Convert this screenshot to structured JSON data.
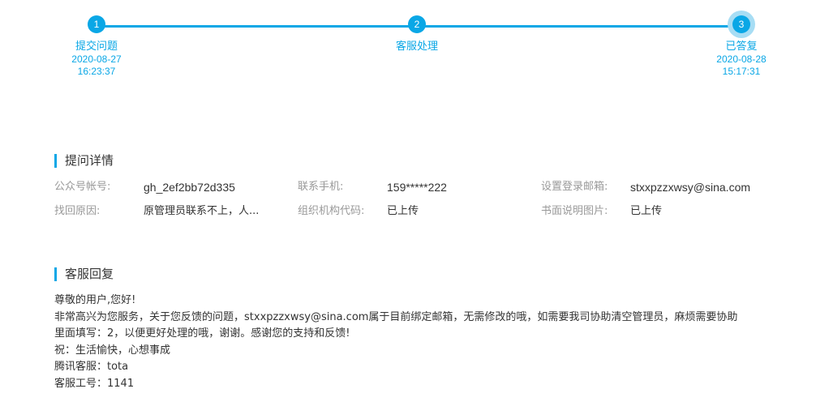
{
  "steps": [
    {
      "num": "1",
      "label": "提交问题",
      "date": "2020-08-27",
      "time": "16:23:37"
    },
    {
      "num": "2",
      "label": "客服处理",
      "date": "",
      "time": ""
    },
    {
      "num": "3",
      "label": "已答复",
      "date": "2020-08-28",
      "time": "15:17:31"
    }
  ],
  "details": {
    "title": "提问详情",
    "official_account_label": "公众号帐号:",
    "official_account_value": "gh_2ef2bb72d335",
    "phone_label": "联系手机:",
    "phone_value": "159*****222",
    "login_email_label": "设置登录邮箱:",
    "login_email_value": "stxxpzzxwsy@sina.com",
    "reason_label": "找回原因:",
    "reason_value": "原管理员联系不上，人...",
    "org_code_label": "组织机构代码:",
    "org_code_value": "已上传",
    "written_image_label": "书面说明图片:",
    "written_image_value": "已上传"
  },
  "reply": {
    "title": "客服回复",
    "lines": [
      "尊敬的用户,您好!",
      "非常高兴为您服务，关于您反馈的问题，stxxpzzxwsy@sina.com属于目前绑定邮箱，无需修改的哦，如需要我司协助清空管理员，麻烦需要协助",
      "里面填写：2，以便更好处理的哦，谢谢。感谢您的支持和反馈!",
      "祝：生活愉快，心想事成",
      "腾讯客服：tota",
      "客服工号：1141"
    ]
  },
  "colors": {
    "accent": "#0aa7e6",
    "halo": "#a7ddf4"
  }
}
